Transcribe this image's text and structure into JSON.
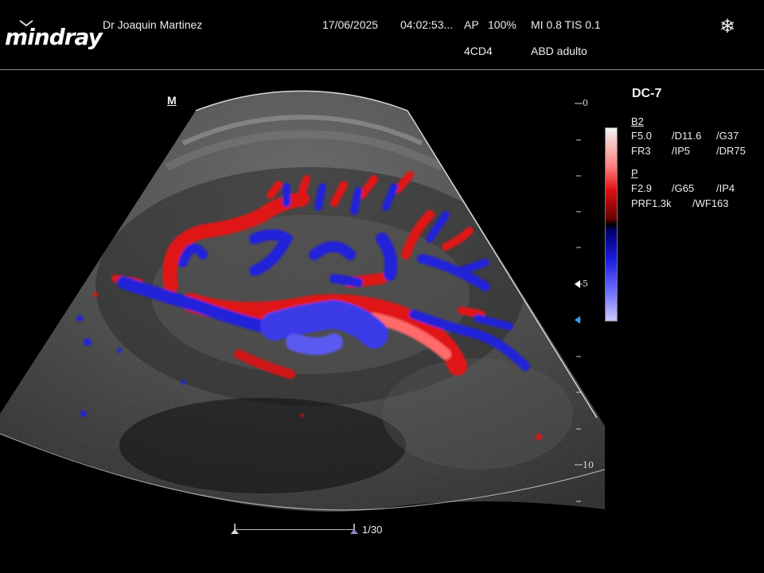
{
  "header": {
    "brand": "mindray",
    "operator": "Dr Joaquin Martinez",
    "date": "17/06/2025",
    "time": "04:02:53...",
    "ap_label": "AP",
    "ap_value": "100%",
    "mi_tis": "MI 0.8 TIS 0.1",
    "probe": "4CD4",
    "preset": "ABD adulto"
  },
  "panel": {
    "probe_model": "DC-7",
    "b_mode": {
      "title": "B2",
      "row1": [
        "F5.0",
        "/D11.6",
        "/G37"
      ],
      "row2": [
        "FR3",
        "/IP5",
        "/DR75"
      ]
    },
    "power_mode": {
      "title": "P",
      "row1": [
        "F2.9",
        "/G65",
        "/IP4"
      ],
      "row2": [
        "PRF1.3k",
        "/WF163"
      ]
    }
  },
  "depth_scale": {
    "labels": [
      "0",
      "5",
      "10"
    ]
  },
  "image": {
    "orientation_mark": "M",
    "frame_counter": "1/30"
  },
  "icons": [
    "freeze-snowflake-icon",
    "focus-marker-icon",
    "depth-marker-icon",
    "cine-start-icon",
    "cine-end-icon"
  ],
  "colors": {
    "flow_red": "#e01818",
    "flow_blue": "#2424d8",
    "background": "#000000"
  }
}
